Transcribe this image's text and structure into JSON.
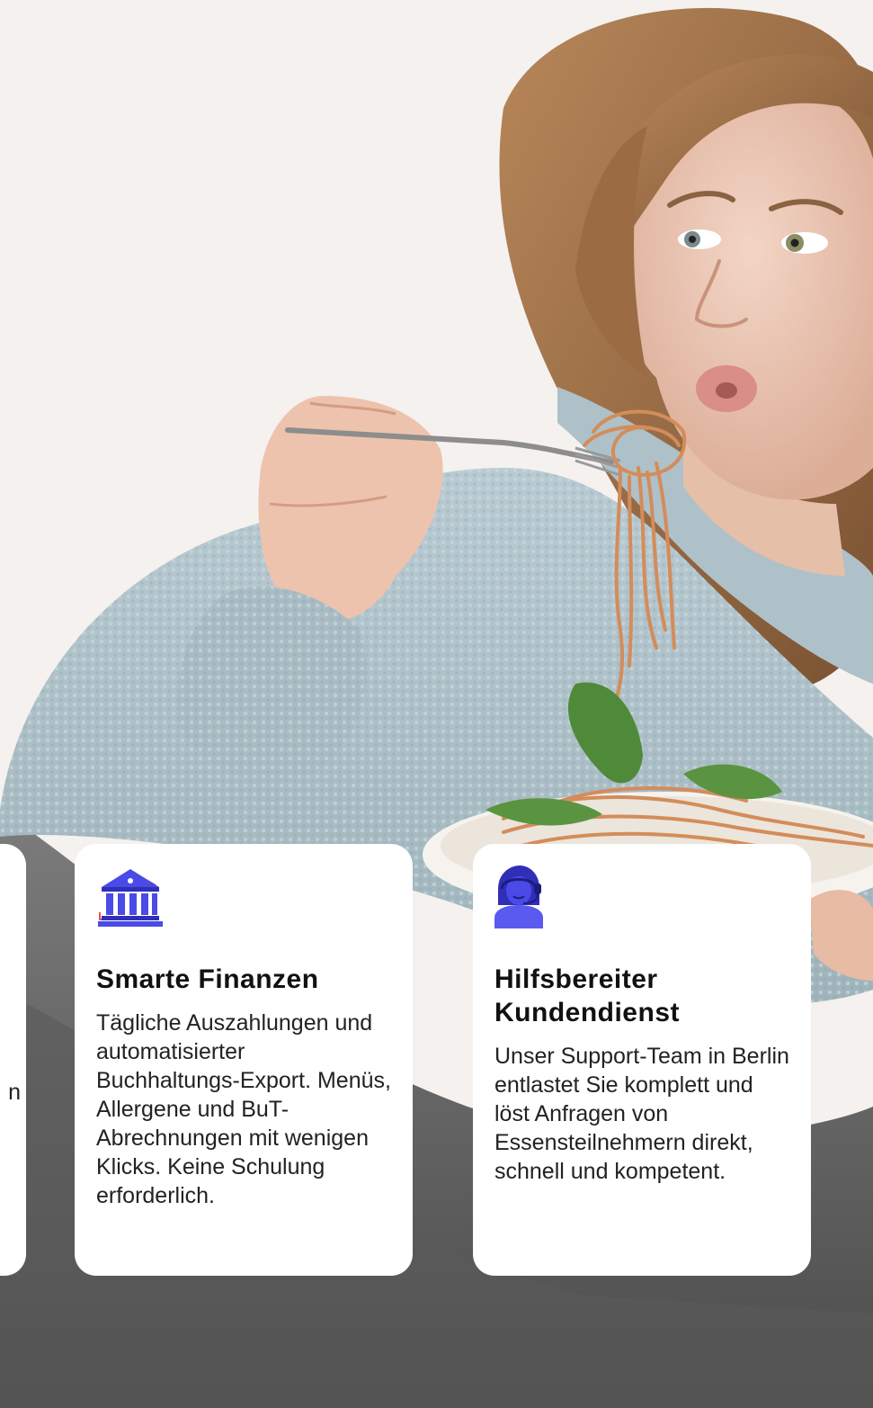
{
  "hero": {
    "image_alt": "Woman in a light blue fleece hoodie eating spaghetti with basil from a plate with a fork"
  },
  "cards": {
    "partial": {
      "text_fragment": "n"
    },
    "finance": {
      "icon": "bank-building-icon",
      "title": "Smarte Finanzen",
      "text": "Tägliche Auszahlungen und automatisierter Buchhaltungs-Export. Menüs, Allergene und BuT-Abrechnungen mit wenigen Klicks. Keine Schulung erforderlich."
    },
    "support": {
      "icon": "support-agent-headset-icon",
      "title": "Hilfsbereiter Kundendienst",
      "text": "Unser Support-Team in Berlin entlastet Sie komplett und löst Anfragen von Essensteilnehmern direkt, schnell und kompetent."
    }
  },
  "colors": {
    "background": "#f4f1ef",
    "card": "#ffffff",
    "icon_primary": "#4a4ae8",
    "icon_accent": "#e8505b",
    "text": "#1b1b1b"
  }
}
